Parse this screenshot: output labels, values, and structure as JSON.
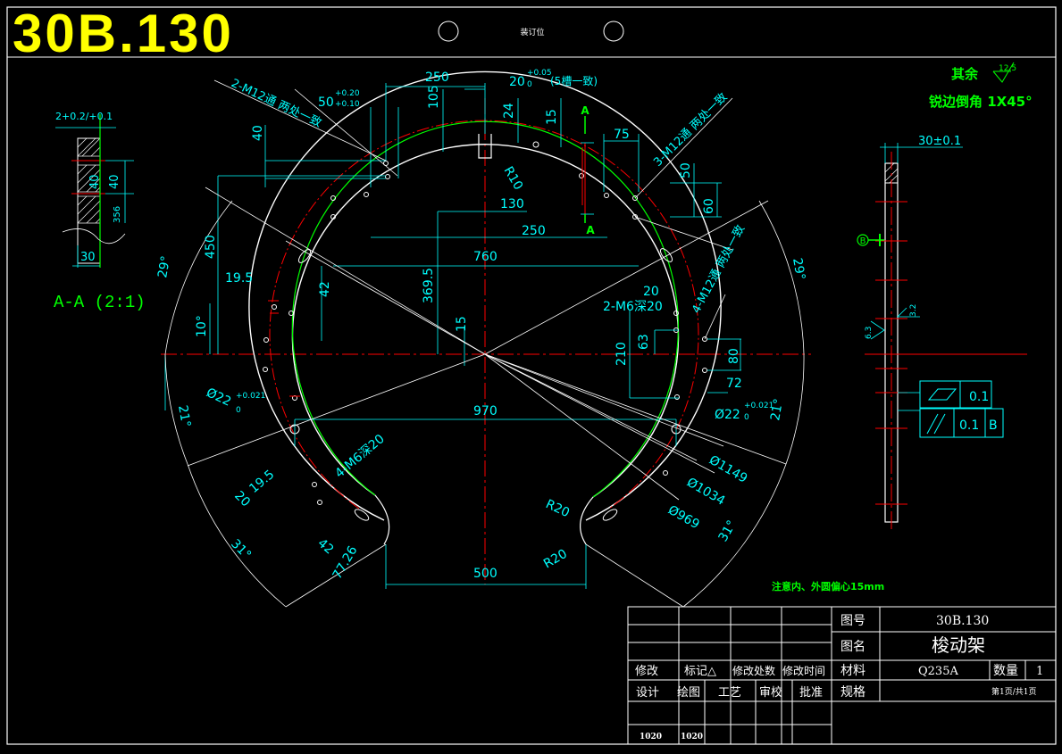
{
  "drawing_number_header": "30B.130",
  "binding_label": "装订位",
  "notes": {
    "roughness": "其余",
    "roughness_value": "12.5",
    "chamfer": "锐边倒角 1X45°",
    "eccentric": "注意内、外圆偏心15mm"
  },
  "section_view": {
    "title": "A-A (2:1)",
    "dims": [
      "2+0.2/+0.1",
      "40",
      "40",
      "356",
      "30"
    ]
  },
  "side_view": {
    "dims": [
      "30±0.1",
      "6.3",
      "3.2"
    ],
    "datum": "B",
    "flatness": "0.1",
    "parallelism": "0.1",
    "parallel_datum": "B"
  },
  "main_view": {
    "dims": [
      "250",
      "105",
      "20",
      "+0.05",
      "0",
      "(5槽一致)",
      "24",
      "15",
      "50",
      "+0.20",
      "+0.10",
      "40",
      "2-M12通 两处一致",
      "75",
      "3-M12通 两处一致",
      "50",
      "60",
      "R10",
      "130",
      "250",
      "450",
      "760",
      "369.5",
      "42",
      "19.5",
      "29°",
      "10°",
      "15",
      "2-M6深20",
      "20",
      "4-M12通 两处一致",
      "29°",
      "63",
      "210",
      "80",
      "72",
      "Ø22",
      "+0.021",
      "0",
      "Ø22",
      "+0.021",
      "0",
      "21°",
      "970",
      "21°",
      "Ø1149",
      "Ø1034",
      "Ø969",
      "4-M6深20",
      "20",
      "19.5",
      "42",
      "77.26",
      "31°",
      "R20",
      "R20",
      "500",
      "31°"
    ],
    "section_mark": "A"
  },
  "title_block": {
    "headers_row1": [
      "修改",
      "标记△",
      "修改处数",
      "修改时间"
    ],
    "headers_row2": [
      "设计",
      "绘图",
      "工艺",
      "审校",
      "批准"
    ],
    "signatures": [
      "1020",
      "1020"
    ],
    "fields": {
      "drawing_no_label": "图号",
      "drawing_no": "30B.130",
      "name_label": "图名",
      "name": "梭动架",
      "material_label": "材料",
      "material": "Q235A",
      "qty_label": "数量",
      "qty": "1",
      "spec_label": "规格",
      "page": "第1页/共1页"
    }
  },
  "colors": {
    "background": "#000000",
    "outline": "#ffffff",
    "dimension": "#00ffff",
    "center": "#ff0000",
    "hidden_circle": "#00ff00",
    "note": "#00ff00",
    "header": "#ffff00"
  }
}
